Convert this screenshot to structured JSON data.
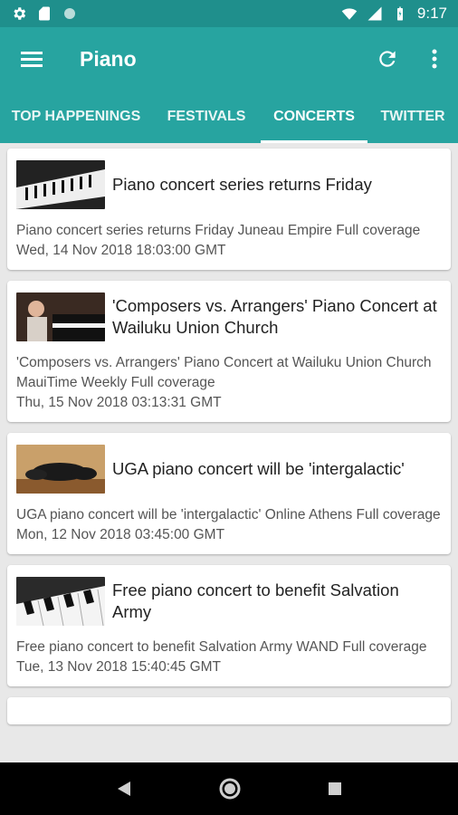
{
  "status_bar": {
    "time": "9:17",
    "icons": [
      "gear-icon",
      "sd-card-icon",
      "circle-icon",
      "wifi-icon",
      "signal-icon",
      "battery-icon"
    ]
  },
  "app_bar": {
    "title": "Piano",
    "icons": [
      "menu-icon",
      "refresh-icon",
      "more-vert-icon"
    ]
  },
  "tabs": [
    {
      "label": "TOP HAPPENINGS",
      "active": false
    },
    {
      "label": "FESTIVALS",
      "active": false
    },
    {
      "label": "CONCERTS",
      "active": true
    },
    {
      "label": "TWITTER",
      "active": false
    }
  ],
  "articles": [
    {
      "title": "Piano concert series returns Friday",
      "description": "Piano concert series returns Friday  Juneau Empire  Full coverage",
      "date": "Wed, 14 Nov 2018 18:03:00 GMT"
    },
    {
      "title": "'Composers vs. Arrangers' Piano Concert at Wailuku Union Church",
      "description": "'Composers vs. Arrangers' Piano Concert at Wailuku Union Church  MauiTime Weekly  Full coverage",
      "date": "Thu, 15 Nov 2018 03:13:31 GMT"
    },
    {
      "title": "UGA piano concert will be 'intergalactic'",
      "description": "UGA piano concert will be 'intergalactic'  Online Athens  Full coverage",
      "date": "Mon, 12 Nov 2018 03:45:00 GMT"
    },
    {
      "title": "Free piano concert to benefit Salvation Army",
      "description": "Free piano concert to benefit Salvation Army  WAND  Full coverage",
      "date": "Tue, 13 Nov 2018 15:40:45 GMT"
    }
  ],
  "colors": {
    "primary": "#27a4a0",
    "primary_dark": "#1f8f8c"
  },
  "nav_bar": {
    "icons": [
      "back-icon",
      "home-icon",
      "recents-icon"
    ]
  }
}
